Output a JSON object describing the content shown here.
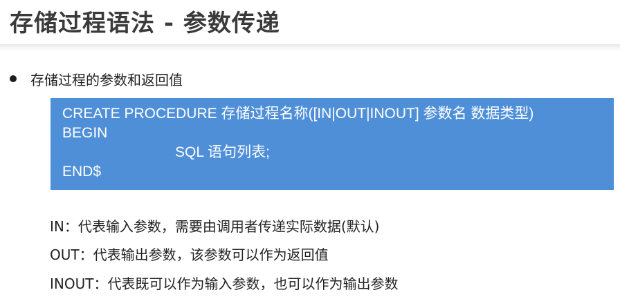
{
  "slide": {
    "title": "存储过程语法 - 参数传递",
    "bullet": "存储过程的参数和返回值",
    "code": {
      "line1": "CREATE PROCEDURE 存储过程名称([IN|OUT|INOUT] 参数名 数据类型)",
      "line2": "BEGIN",
      "line3": "SQL 语句列表;",
      "line4": "END$"
    },
    "descriptions": [
      "IN：代表输入参数，需要由调用者传递实际数据(默认)",
      "OUT：代表输出参数，该参数可以作为返回值",
      "INOUT：代表既可以作为输入参数，也可以作为输出参数"
    ]
  },
  "colors": {
    "code_background": "#4f8fd8",
    "code_text": "#ffffff",
    "title_text": "#3a3a3a"
  }
}
